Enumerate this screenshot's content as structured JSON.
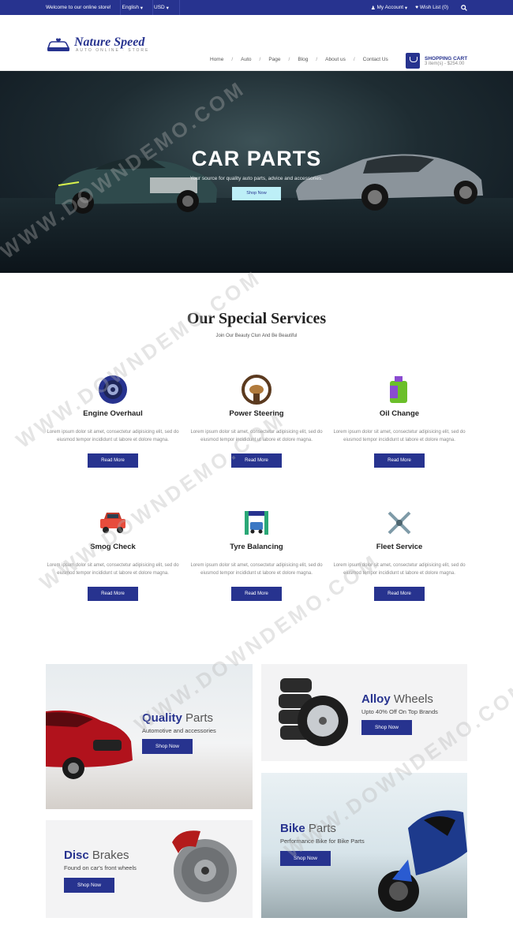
{
  "topbar": {
    "welcome": "Welcome to our online store!",
    "language": "English",
    "currency": "USD",
    "account": "My Account",
    "wishlist": "Wish List (0)"
  },
  "logo": {
    "brand": "Nature Speed",
    "tagline": "AUTO ONLINE · STORE"
  },
  "nav": [
    "Home",
    "Auto",
    "Page",
    "Blog",
    "About us",
    "Contact Us"
  ],
  "cart": {
    "title": "SHOPPING CART",
    "summary": "3 item(s) - $254.00"
  },
  "hero": {
    "title": "CAR PARTS",
    "subtitle": "Your source for quality auto parts, advice and accessories.",
    "button": "Shop Now"
  },
  "services": {
    "title": "Our Special Services",
    "subtitle": "Join Our Beauty Clun And Be Beautiful",
    "items": [
      {
        "name": "Engine Overhaul",
        "icon": "engine-icon",
        "text": "Lorem ipsum dolor sit amet, consectetur adipisicing elit, sed do eiusmod tempor incididunt ut labore et dolore magna.",
        "button": "Read More"
      },
      {
        "name": "Power Steering",
        "icon": "steering-icon",
        "text": "Lorem ipsum dolor sit amet, consectetur adipisicing elit, sed do eiusmod tempor incididunt ut labore et dolore magna.",
        "button": "Read More"
      },
      {
        "name": "Oil Change",
        "icon": "oil-can-icon",
        "text": "Lorem ipsum dolor sit amet, consectetur adipisicing elit, sed do eiusmod tempor incididunt ut labore et dolore magna.",
        "button": "Read More"
      },
      {
        "name": "Smog Check",
        "icon": "car-icon",
        "text": "Lorem ipsum dolor sit amet, consectetur adipisicing elit, sed do eiusmod tempor incididunt ut labore et dolore magna.",
        "button": "Read More"
      },
      {
        "name": "Tyre Balancing",
        "icon": "car-wash-icon",
        "text": "Lorem ipsum dolor sit amet, consectetur adipisicing elit, sed do eiusmod tempor incididunt ut labore et dolore magna.",
        "button": "Read More"
      },
      {
        "name": "Fleet Service",
        "icon": "wrench-icon",
        "text": "Lorem ipsum dolor sit amet, consectetur adipisicing elit, sed do eiusmod tempor incididunt ut labore et dolore magna.",
        "button": "Read More"
      }
    ]
  },
  "banners": {
    "quality": {
      "bold": "Quality",
      "light": "Parts",
      "text": "Automotive and accessories",
      "button": "Shop Now"
    },
    "alloy": {
      "bold": "Alloy",
      "light": "Wheels",
      "text": "Upto 40% Off On Top Brands",
      "button": "Shop Now"
    },
    "disc": {
      "bold": "Disc",
      "light": "Brakes",
      "text": "Found on car's front wheels",
      "button": "Shop Now"
    },
    "bike": {
      "bold": "Bike",
      "light": "Parts",
      "text": "Performance Bike for Bike Parts",
      "button": "Shop Now"
    }
  },
  "watermark": "WWW.DOWNDEMO.COM",
  "colors": {
    "primary": "#27338f",
    "hero_button": "#bdeff7"
  }
}
